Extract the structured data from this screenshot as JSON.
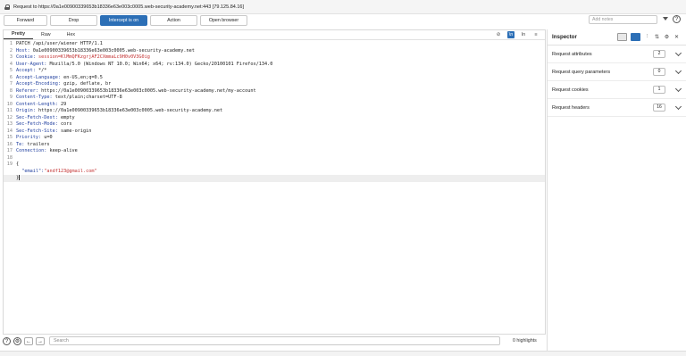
{
  "request_info": "Request to https://0a1e00900339653b18336e63e003c0005.web-security-academy.net:443  [79.125.84.16]",
  "toolbar": {
    "forward": "Forward",
    "drop": "Drop",
    "intercept": "Intercept is on",
    "action": "Action",
    "open_browser": "Open browser",
    "notes_placeholder": "Add notes"
  },
  "editor": {
    "tabs": [
      "Pretty",
      "Raw",
      "Hex"
    ],
    "lines": [
      {
        "n": "1",
        "name": "PATCH /api/user/wiener HTTP/1.1",
        "value": ""
      },
      {
        "n": "2",
        "name": "Host: ",
        "value": "0a1e00900339653b18336e63e003c0005.web-security-academy.net"
      },
      {
        "n": "3",
        "name": "Cookie: ",
        "value": "session=KlMmQFKzgrjAF2CXmmaLc9H0v0V3G0ig"
      },
      {
        "n": "4",
        "name": "User-Agent: ",
        "value": "Mozilla/5.0 (Windows NT 10.0; Win64; x64; rv:134.0) Gecko/20100101 Firefox/134.0"
      },
      {
        "n": "5",
        "name": "Accept: ",
        "value": "*/*"
      },
      {
        "n": "6",
        "name": "Accept-Language: ",
        "value": "en-US,en;q=0.5"
      },
      {
        "n": "7",
        "name": "Accept-Encoding: ",
        "value": "gzip, deflate, br"
      },
      {
        "n": "8",
        "name": "Referer: ",
        "value": "https://0a1e00900339653b18336e63e003c0005.web-security-academy.net/my-account"
      },
      {
        "n": "9",
        "name": "Content-Type: ",
        "value": "text/plain;charset=UTF-8"
      },
      {
        "n": "10",
        "name": "Content-Length: ",
        "value": "29"
      },
      {
        "n": "11",
        "name": "Origin: ",
        "value": "https://0a1e00900339653b18336e63e003c0005.web-security-academy.net"
      },
      {
        "n": "12",
        "name": "Sec-Fetch-Dest: ",
        "value": "empty"
      },
      {
        "n": "13",
        "name": "Sec-Fetch-Mode: ",
        "value": "cors"
      },
      {
        "n": "14",
        "name": "Sec-Fetch-Site: ",
        "value": "same-origin"
      },
      {
        "n": "15",
        "name": "Priority: ",
        "value": "u=0"
      },
      {
        "n": "16",
        "name": "Te: ",
        "value": "trailers"
      },
      {
        "n": "17",
        "name": "Connection: ",
        "value": "keep-alive"
      },
      {
        "n": "18",
        "name": "",
        "value": ""
      },
      {
        "n": "19",
        "name": "{",
        "value": ""
      },
      {
        "n": "",
        "name": "  \"email\":",
        "value": "\"andf123@gmail.com\""
      },
      {
        "n": "",
        "name": "}",
        "value": ""
      }
    ]
  },
  "bottom": {
    "search_placeholder": "Search",
    "highlights": "0 highlights"
  },
  "inspector": {
    "title": "Inspector",
    "rows": [
      {
        "label": "Request attributes",
        "count": "2"
      },
      {
        "label": "Request query parameters",
        "count": "0"
      },
      {
        "label": "Request cookies",
        "count": "1"
      },
      {
        "label": "Request headers",
        "count": "16"
      }
    ]
  }
}
